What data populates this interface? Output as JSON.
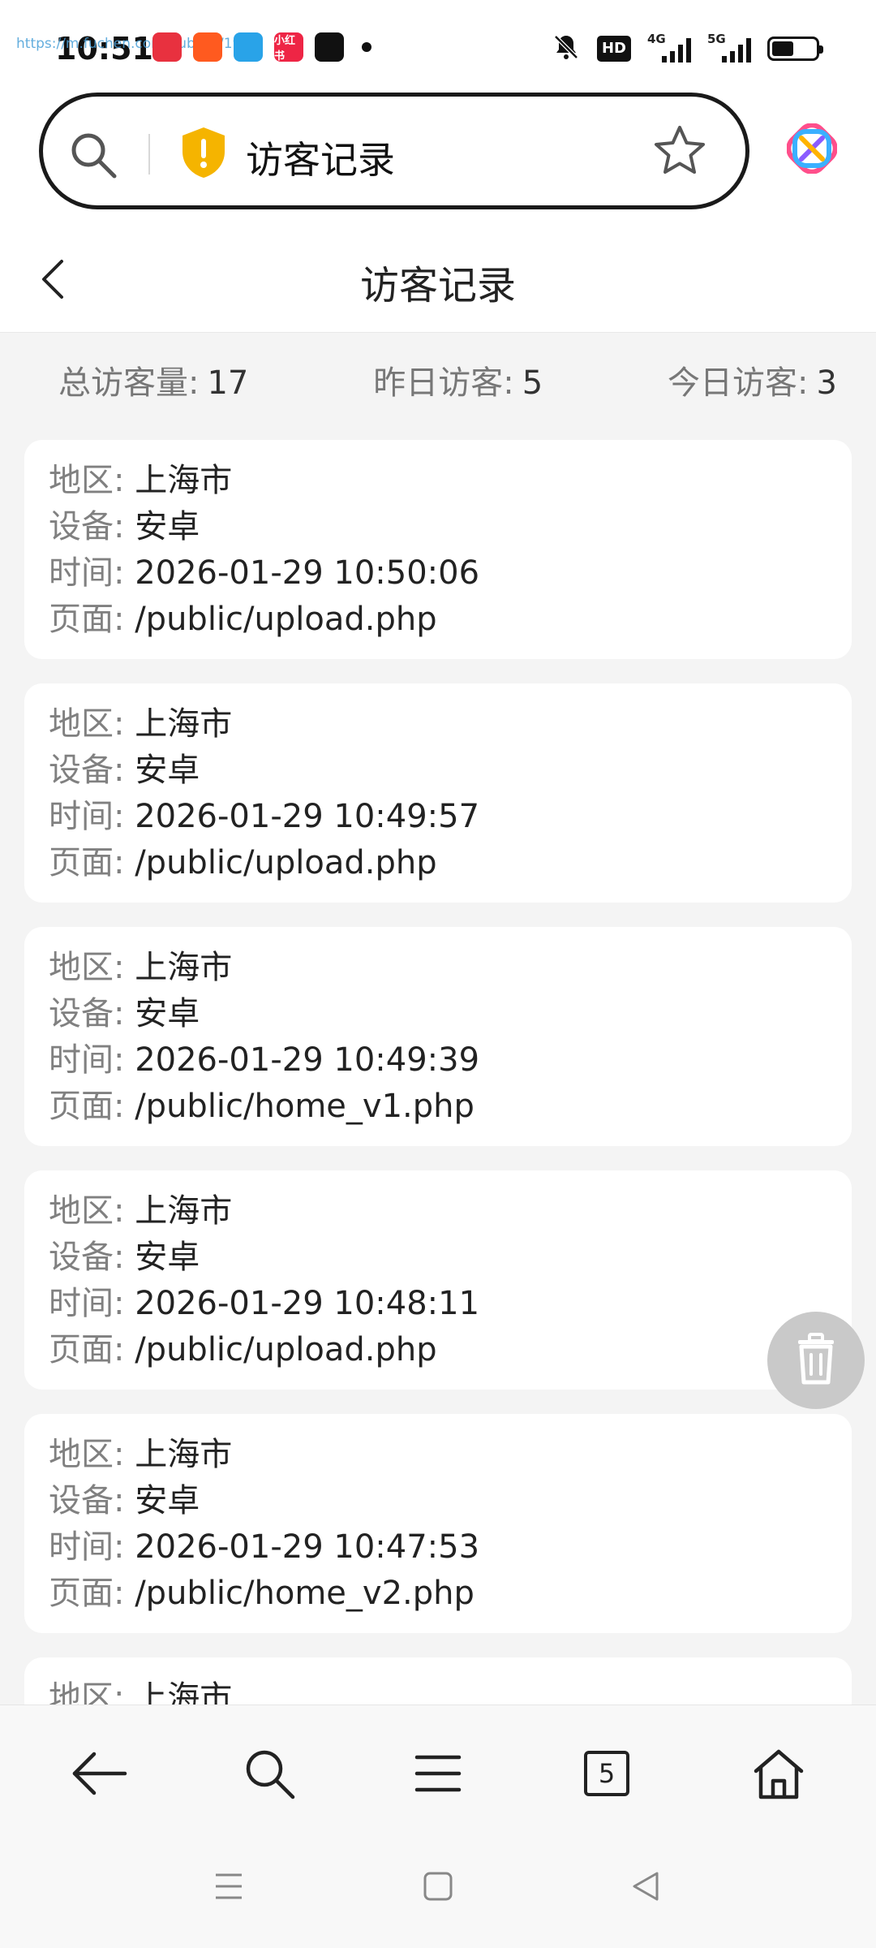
{
  "status_bar": {
    "time": "10:51",
    "url_overlay": "https://m.fuchen.com/public/i/1933",
    "apps": [
      {
        "name": "red-app-icon",
        "color": "#e8313f",
        "text": ""
      },
      {
        "name": "kuaishou-icon",
        "color": "#ff5a1f",
        "text": ""
      },
      {
        "name": "qq-icon",
        "color": "#29a3e8",
        "text": ""
      },
      {
        "name": "xiaohongshu-icon",
        "color": "#ee2545",
        "text": "小红书"
      },
      {
        "name": "douyin-icon",
        "color": "#111111",
        "text": ""
      }
    ],
    "hd_label": "HD",
    "net1": "4G",
    "net2": "5G"
  },
  "browser": {
    "address_title": "访客记录"
  },
  "header": {
    "title": "访客记录"
  },
  "stats": {
    "total_label": "总访客量:",
    "total_value": "17",
    "yesterday_label": "昨日访客:",
    "yesterday_value": "5",
    "today_label": "今日访客:",
    "today_value": "3"
  },
  "labels": {
    "region": "地区: ",
    "device": "设备: ",
    "time": "时间: ",
    "page": "页面: "
  },
  "records": [
    {
      "region": "上海市",
      "device": "安卓",
      "time": "2026-01-29 10:50:06",
      "page": "/public/upload.php"
    },
    {
      "region": "上海市",
      "device": "安卓",
      "time": "2026-01-29 10:49:57",
      "page": "/public/upload.php"
    },
    {
      "region": "上海市",
      "device": "安卓",
      "time": "2026-01-29 10:49:39",
      "page": "/public/home_v1.php"
    },
    {
      "region": "上海市",
      "device": "安卓",
      "time": "2026-01-29 10:48:11",
      "page": "/public/upload.php"
    },
    {
      "region": "上海市",
      "device": "安卓",
      "time": "2026-01-29 10:47:53",
      "page": "/public/home_v2.php"
    },
    {
      "region": "上海市",
      "device": "",
      "time": "",
      "page": ""
    }
  ],
  "bottom_nav": {
    "tab_count": "5"
  }
}
